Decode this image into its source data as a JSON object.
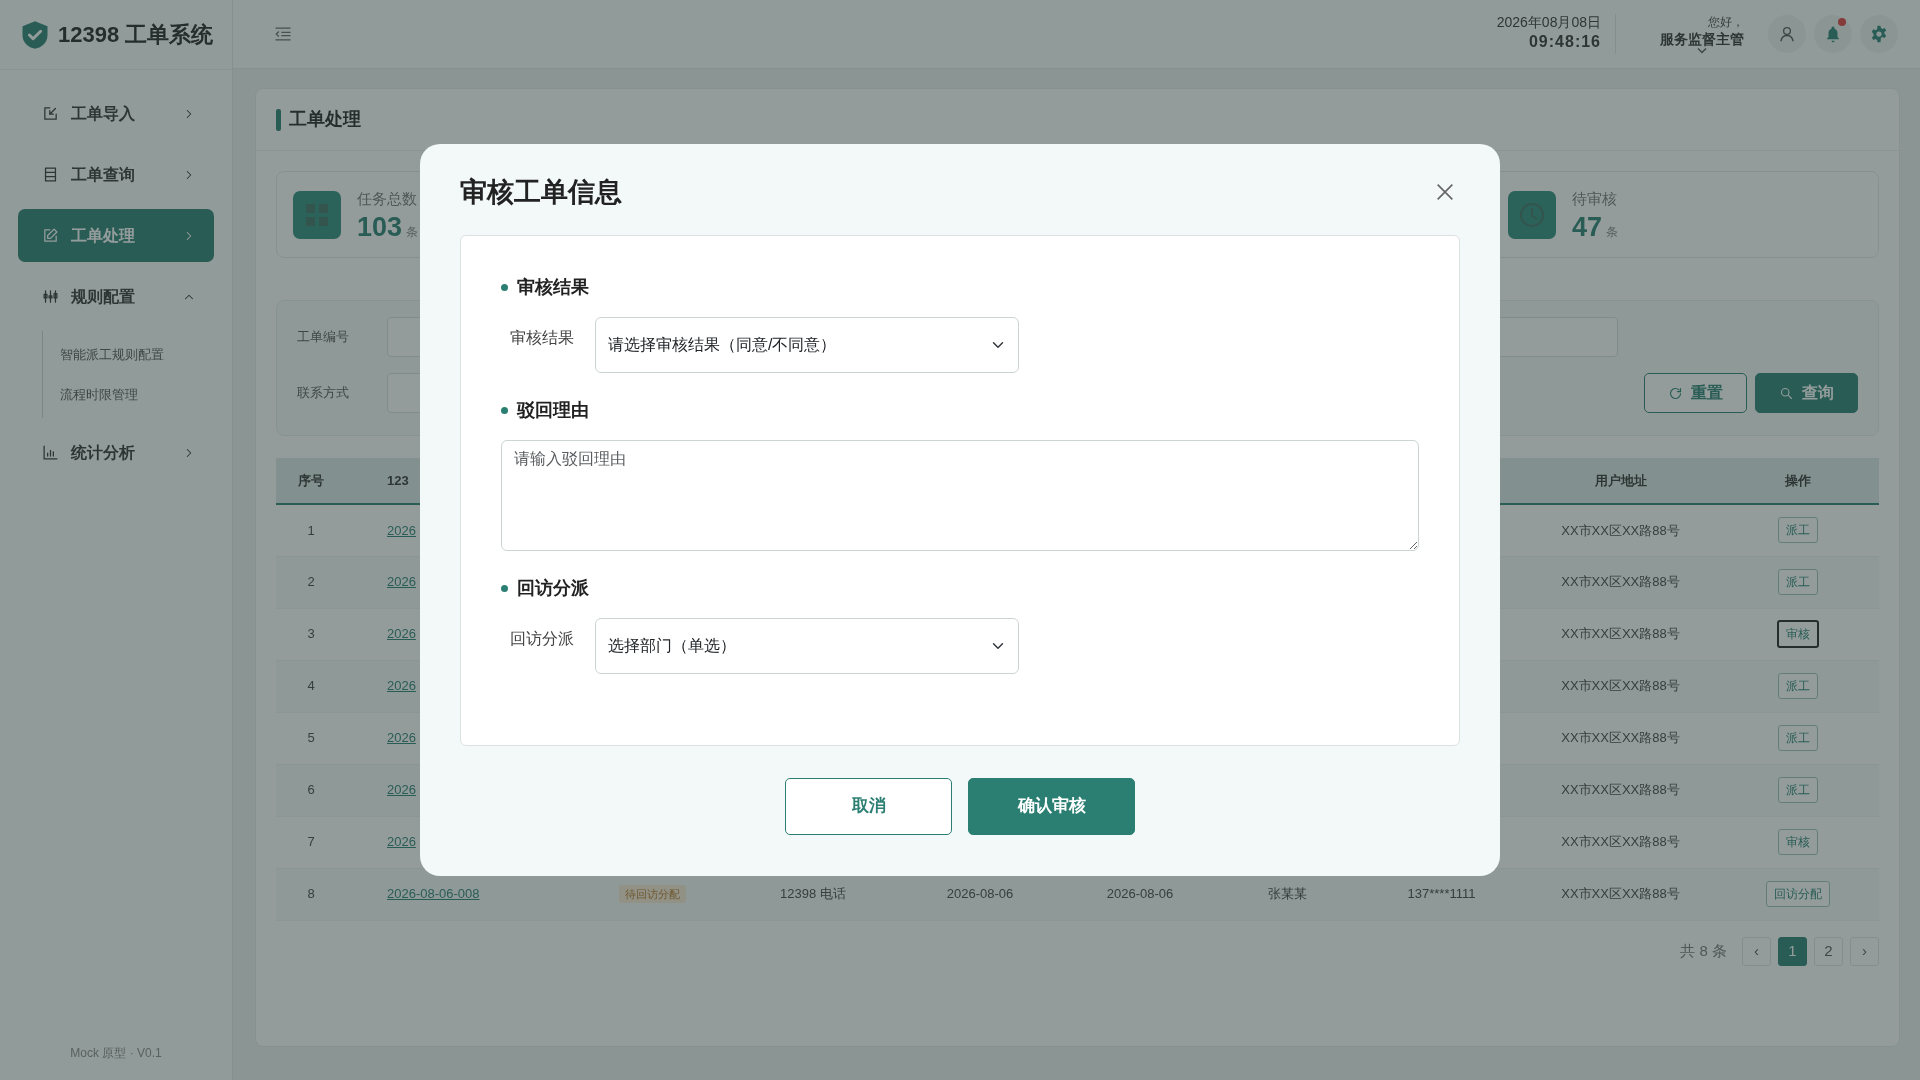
{
  "sidebar": {
    "title": "12398 工单系统",
    "items": [
      {
        "label": "工单导入",
        "selected": false,
        "expanded": false
      },
      {
        "label": "工单查询",
        "selected": false,
        "expanded": false
      },
      {
        "label": "工单处理",
        "selected": true,
        "expanded": false
      },
      {
        "label": "规则配置",
        "selected": false,
        "expanded": true,
        "children": [
          {
            "label": "智能派工规则配置"
          },
          {
            "label": "流程时限管理"
          }
        ]
      },
      {
        "label": "统计分析",
        "selected": false,
        "expanded": false
      }
    ],
    "footer": "Mock 原型 · V0.1"
  },
  "topbar": {
    "date": "2026年08月08日",
    "time": "09:48:16",
    "greeting": "您好，",
    "user": "服务监督主管",
    "unread": true
  },
  "page": {
    "title": "工单处理"
  },
  "stats": [
    {
      "label": "任务总数",
      "value": "103",
      "unit": "条"
    },
    {
      "label": "待审核",
      "value": "47",
      "unit": "条"
    }
  ],
  "filters": {
    "fields": [
      {
        "kind": "labeled",
        "label": "工单编号"
      },
      {
        "kind": "labeled",
        "label": "联系方式"
      },
      {
        "kind": "bare"
      }
    ],
    "buttons": [
      {
        "label": "重置",
        "kind": "reset"
      },
      {
        "label": "查询",
        "kind": "search"
      }
    ]
  },
  "table": {
    "columns": {
      "column_1": "序号",
      "column_2": "123",
      "column_9": "用户地址",
      "column_10": "操作"
    },
    "rows": [
      {
        "column_1": "1",
        "column_2": "2026",
        "column_9": "XX市XX区XX路88号",
        "column_10": {
          "label": "派工",
          "focused": false
        }
      },
      {
        "column_1": "2",
        "column_2": "2026",
        "column_9": "XX市XX区XX路88号",
        "column_10": {
          "label": "派工",
          "focused": false
        }
      },
      {
        "column_1": "3",
        "column_2": "2026",
        "column_9": "XX市XX区XX路88号",
        "column_10": {
          "label": "审核",
          "focused": true
        }
      },
      {
        "column_1": "4",
        "column_2": "2026",
        "column_9": "XX市XX区XX路88号",
        "column_10": {
          "label": "派工",
          "focused": false
        }
      },
      {
        "column_1": "5",
        "column_2": "2026",
        "column_9": "XX市XX区XX路88号",
        "column_10": {
          "label": "派工",
          "focused": false
        }
      },
      {
        "column_1": "6",
        "column_2": "2026",
        "column_9": "XX市XX区XX路88号",
        "column_10": {
          "label": "派工",
          "focused": false
        }
      },
      {
        "column_1": "7",
        "column_2": "2026",
        "column_9": "XX市XX区XX路88号",
        "column_10": {
          "label": "审核",
          "focused": false
        }
      },
      {
        "column_1": "8",
        "column_2": "2026-08-06-008",
        "column_3": "待回访分配",
        "column_4": "12398 电话",
        "column_5": "2026-08-06",
        "column_6": "2026-08-06",
        "column_7": "张某某",
        "column_8": "137****1111",
        "column_9": "XX市XX区XX路88号",
        "column_10": {
          "label": "回访分配",
          "focused": false
        }
      }
    ]
  },
  "pagination": {
    "total": "共 8 条",
    "prev": "‹",
    "next": "›",
    "pages": [
      {
        "label": "1",
        "selected": true
      },
      {
        "label": "2",
        "selected": false
      }
    ]
  },
  "dialog": {
    "title": "审核工单信息",
    "sections": [
      {
        "heading": "审核结果",
        "kind": "select",
        "label": "审核结果",
        "value": "请选择审核结果（同意/不同意）"
      },
      {
        "heading": "驳回理由",
        "kind": "textarea",
        "placeholder": "请输入驳回理由"
      },
      {
        "heading": "回访分派",
        "kind": "select",
        "label": "回访分派",
        "value": "选择部门（单选）"
      }
    ],
    "buttons": [
      {
        "label": "取消",
        "kind": "secondary"
      },
      {
        "label": "确认审核",
        "kind": "primary"
      }
    ]
  }
}
